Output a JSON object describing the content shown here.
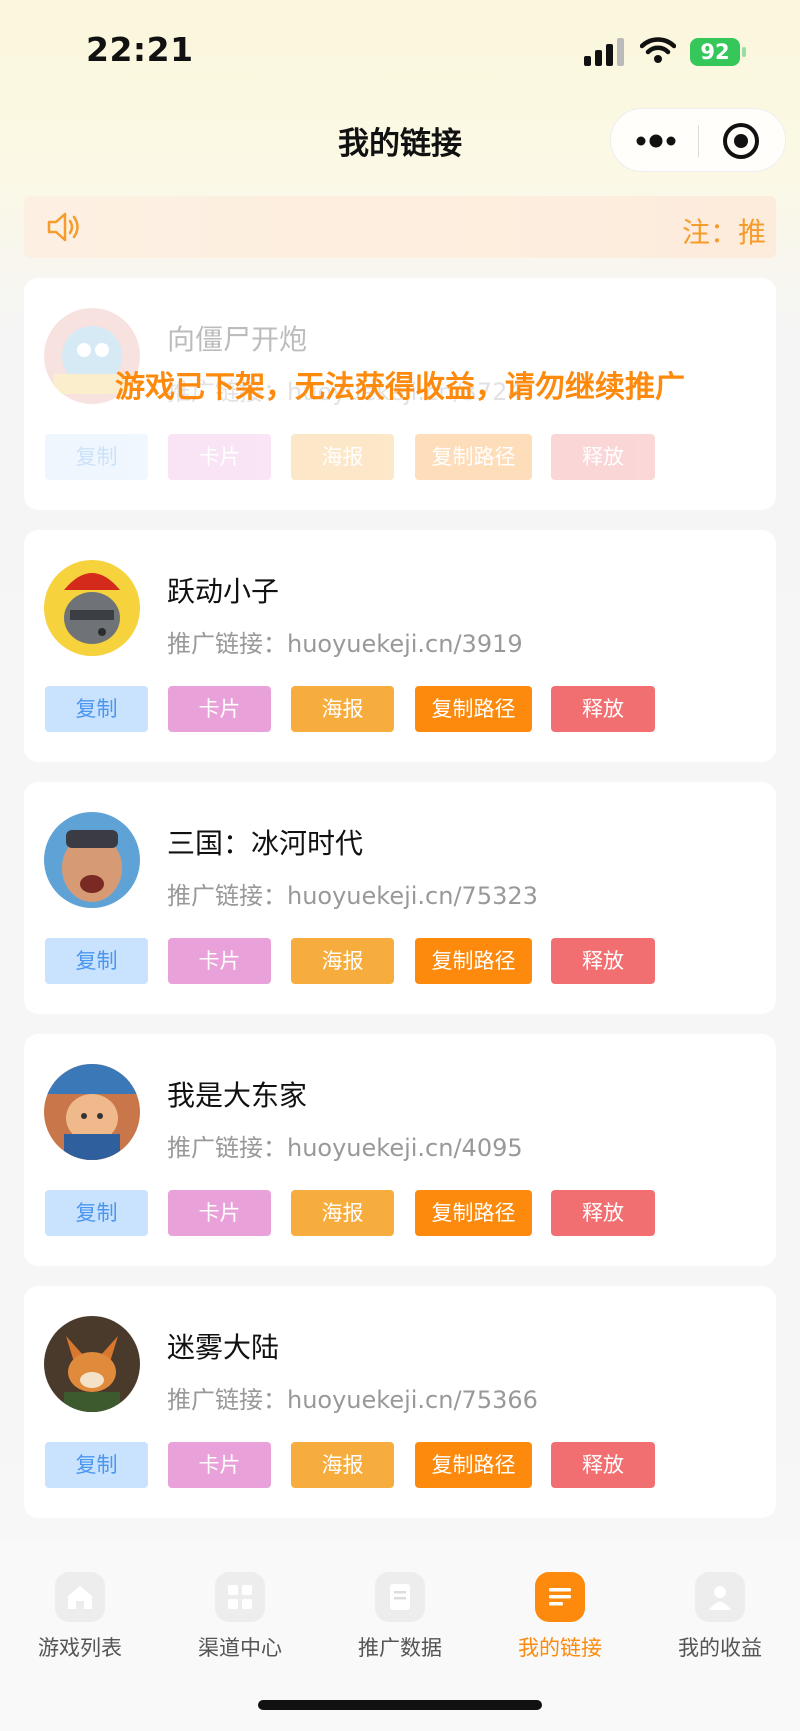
{
  "status_bar": {
    "time": "22:21",
    "battery": "92"
  },
  "nav": {
    "title": "我的链接"
  },
  "notice": {
    "text": "注：推"
  },
  "link_prefix": "推广链接：",
  "buttons": {
    "copy": "复制",
    "card": "卡片",
    "poster": "海报",
    "copy_path": "复制路径",
    "release": "释放"
  },
  "delisted": {
    "name": "向僵尸开炮",
    "link": "推广链接：huoyuekeji.cn/3724",
    "message": "游戏已下架，无法获得收益，请勿继续推广"
  },
  "games": [
    {
      "name": "跃动小子",
      "url": "huoyuekeji.cn/3919"
    },
    {
      "name": "三国：冰河时代",
      "url": "huoyuekeji.cn/75323"
    },
    {
      "name": "我是大东家",
      "url": "huoyuekeji.cn/4095"
    },
    {
      "name": "迷雾大陆",
      "url": "huoyuekeji.cn/75366"
    }
  ],
  "tabs": [
    {
      "label": "游戏列表",
      "icon": "home-icon"
    },
    {
      "label": "渠道中心",
      "icon": "grid-icon"
    },
    {
      "label": "推广数据",
      "icon": "document-icon"
    },
    {
      "label": "我的链接",
      "icon": "list-icon",
      "active": true
    },
    {
      "label": "我的收益",
      "icon": "user-icon"
    }
  ],
  "colors": {
    "accent": "#fd8a0c",
    "copy": "#4b97f0",
    "card": "#e9a1da",
    "poster": "#f7ad3e",
    "release": "#f26f71"
  }
}
